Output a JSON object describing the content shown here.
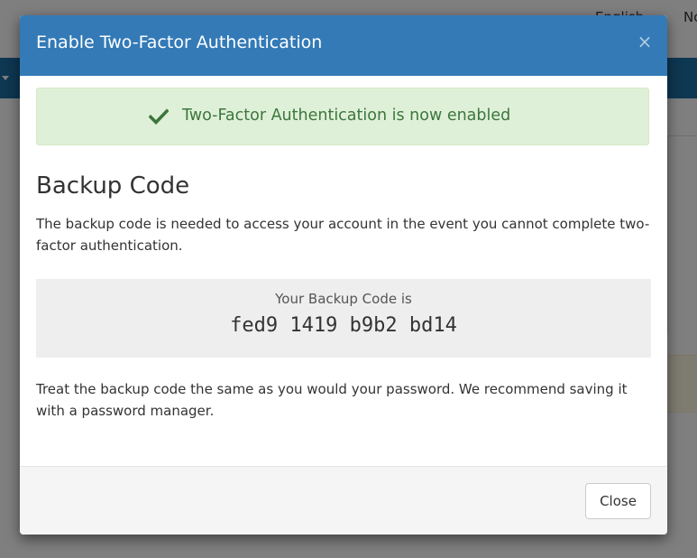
{
  "background": {
    "language_label": "English",
    "notifications_label": "No"
  },
  "modal": {
    "title": "Enable Two-Factor Authentication",
    "close_icon": "close-icon",
    "close_glyph": "×",
    "header_color": "#337ab7",
    "alert": {
      "icon": "checkmark-icon",
      "text": "Two-Factor Authentication is now enabled",
      "color": "#3c763d",
      "background": "#dff0d8"
    },
    "section_title": "Backup Code",
    "description": "The backup code is needed to access your account in the event you cannot complete two-factor authentication.",
    "code_label": "Your Backup Code is",
    "code_value": "fed9 1419 b9b2 bd14",
    "note": "Treat the backup code the same as you would your password. We recommend saving it with a password manager.",
    "footer": {
      "close_label": "Close"
    }
  }
}
